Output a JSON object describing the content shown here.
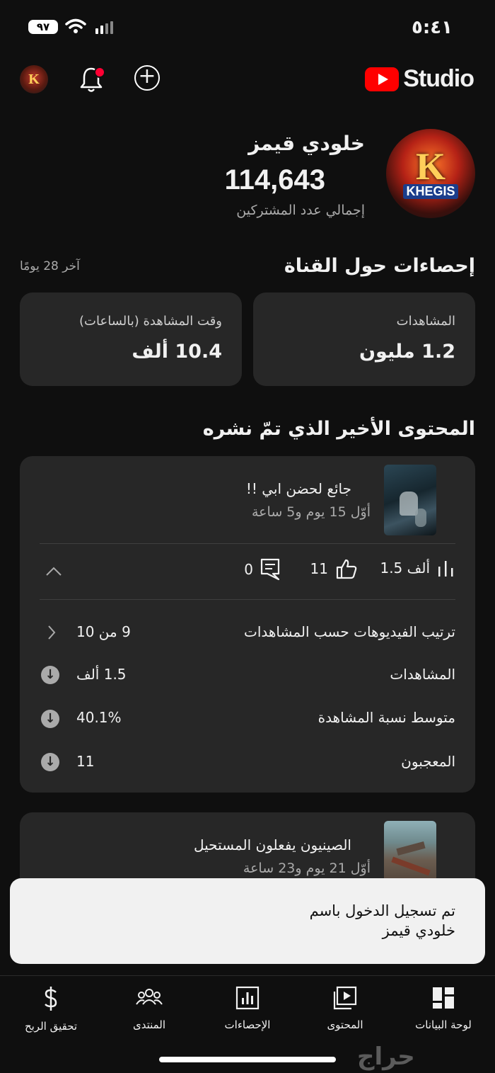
{
  "status_bar": {
    "time": "٥:٤١",
    "battery": "٩٧"
  },
  "header": {
    "brand": "Studio"
  },
  "channel": {
    "name": "خلودي قيمز",
    "subscribers": "114,643",
    "subscribers_label": "إجمالي عدد المشتركين",
    "avatar_letter": "K",
    "avatar_text": "KHEGIS"
  },
  "insights": {
    "title": "إحصاءات حول القناة",
    "period": "آخر 28 يومًا",
    "views_label": "المشاهدات",
    "views_value": "1.2 مليون",
    "watch_label": "وقت المشاهدة (بالساعات)",
    "watch_value": "10.4 ألف"
  },
  "recent": {
    "title": "المحتوى الأخير الذي تمّ نشره",
    "video1": {
      "title": "جائع لحضن ابي !!",
      "date": "أوّل 15 يوم و5 ساعة",
      "views": "1.5 ألف",
      "likes": "11",
      "comments": "0",
      "rows": [
        {
          "label": "ترتيب الفيديوهات حسب المشاهدات",
          "value": "9 من 10"
        },
        {
          "label": "المشاهدات",
          "value": "1.5 ألف"
        },
        {
          "label": "متوسط نسبة المشاهدة",
          "value": "40.1%"
        },
        {
          "label": "المعجبون",
          "value": "11"
        }
      ]
    },
    "video2": {
      "title": "الصينيون يفعلون المستحيل",
      "date": "أوّل 21 يوم و23 ساعة"
    }
  },
  "toast": {
    "line1": "تم تسجيل الدخول باسم",
    "line2": "خلودي قيمز"
  },
  "nav": {
    "dashboard": "لوحة البيانات",
    "content": "المحتوى",
    "analytics": "الإحصاءات",
    "community": "المنتدى",
    "earn": "تحقيق الربح"
  },
  "watermark": "حراج",
  "colors": {
    "background": "#0f0f0f",
    "card": "#272727",
    "accent": "#ff0000"
  }
}
